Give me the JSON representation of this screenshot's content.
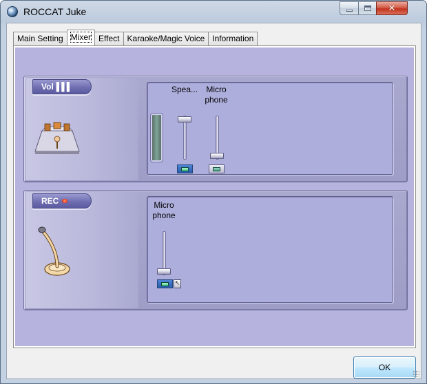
{
  "window": {
    "title": "ROCCAT Juke",
    "icon": "roccat-globe-icon",
    "controls": {
      "minimize_icon": "minimize-icon",
      "maximize_icon": "maximize-icon",
      "close_icon": "close-icon",
      "close_glyph": "✕"
    }
  },
  "tabs": [
    {
      "label": "Main Setting",
      "active": false
    },
    {
      "label": "Mixer",
      "active": true
    },
    {
      "label": "Effect",
      "active": false
    },
    {
      "label": "Karaoke/Magic Voice",
      "active": false
    },
    {
      "label": "Information",
      "active": false
    }
  ],
  "mixer": {
    "volume_panel": {
      "tab_label": "Vol",
      "tab_glyph": "▌▌▌",
      "icon": "speaker-stage-icon",
      "channels": [
        {
          "label": "Spea...",
          "level": 0.9,
          "muted": false
        },
        {
          "label": "Micro phone",
          "label_line1": "Micro",
          "label_line2": "phone",
          "level": 0.08,
          "muted": true
        }
      ]
    },
    "record_panel": {
      "tab_label": "REC",
      "icon": "microphone-icon",
      "channels": [
        {
          "label_line1": "Micro",
          "label_line2": "phone",
          "level": 0.08,
          "muted": false
        }
      ]
    }
  },
  "footer": {
    "ok_label": "OK"
  },
  "colors": {
    "mixer_background": "#b6b4de",
    "panel_tab": "#6f6eb1",
    "mute_active": "#2a5cab",
    "ok_border": "#3c7fb1"
  }
}
